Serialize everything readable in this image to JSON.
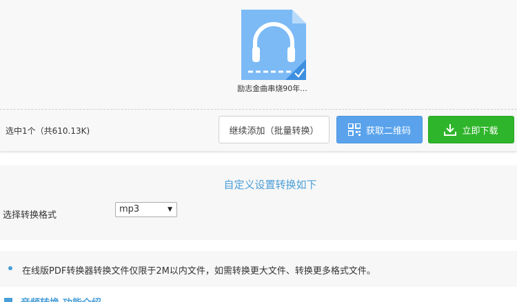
{
  "file": {
    "name": "励志金曲串烧90年..."
  },
  "action_bar": {
    "selection_info": "选中1个（共610.13K)",
    "add_button_label": "继续添加（批量转换）",
    "qr_button_label": "获取二维码",
    "download_button_label": "立即下载"
  },
  "settings": {
    "title": "自定义设置转换如下",
    "format_label": "选择转换格式",
    "format_selected": "mp3"
  },
  "notice": {
    "text": "在线版PDF转换器转换文件仅限于2M以内文件，如需转换更大文件、转换更多格式文件。"
  },
  "bottom": {
    "heading": "音频转换 功能介绍"
  },
  "colors": {
    "accent_blue": "#4a9fd8",
    "qr_button": "#5aa3ec",
    "download_button": "#2fb52b",
    "file_icon": "#7cbaf6"
  }
}
